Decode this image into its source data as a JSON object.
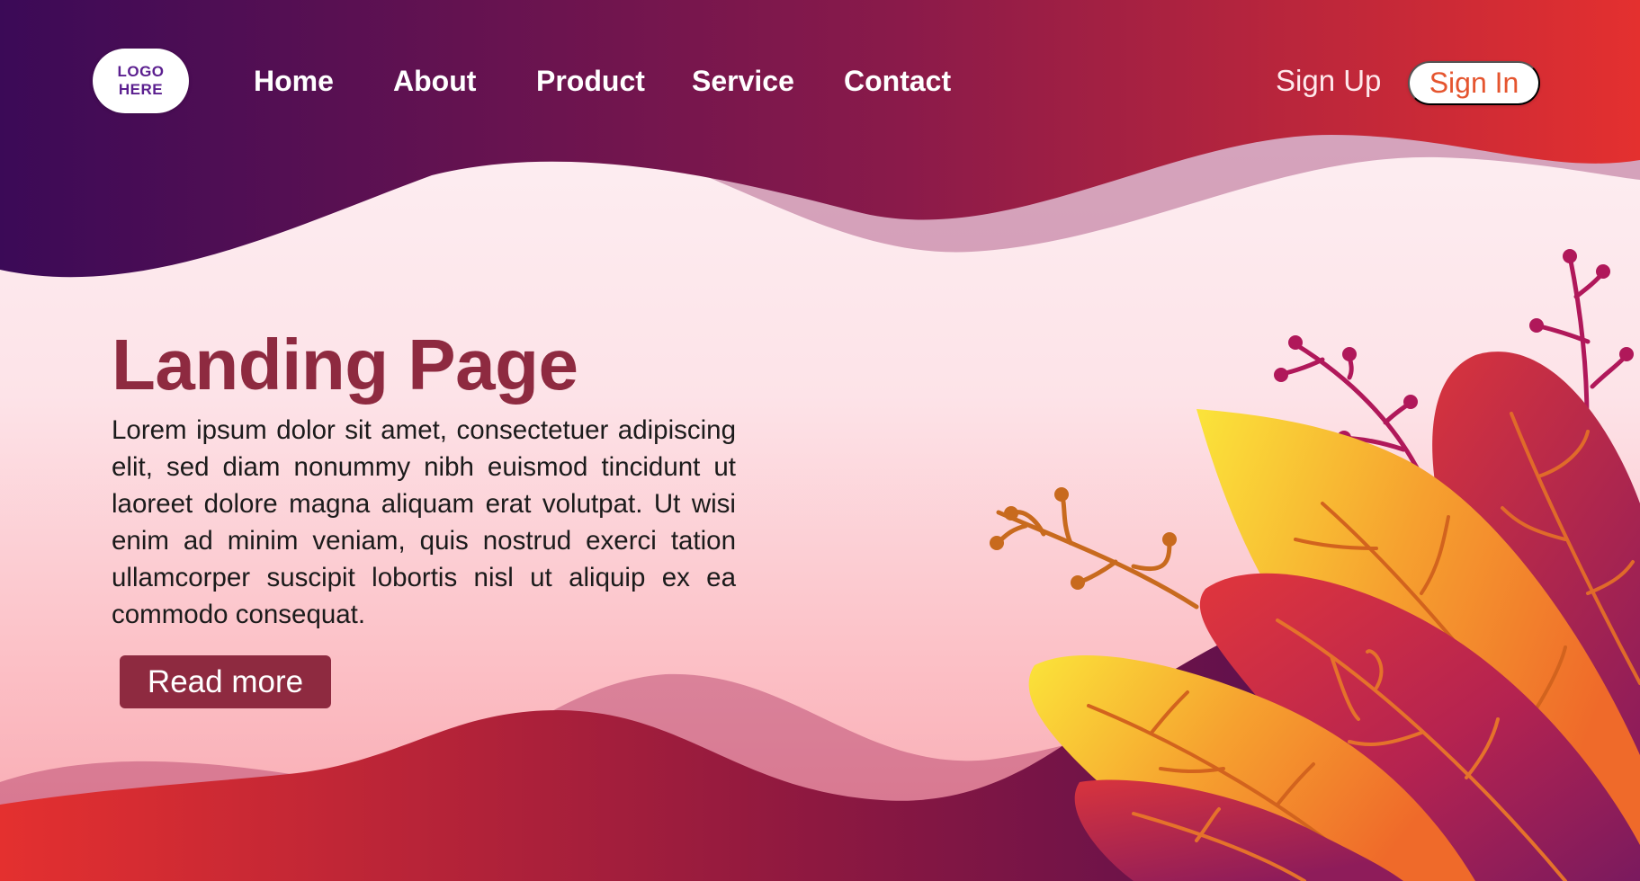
{
  "header": {
    "logo_line1": "LOGO",
    "logo_line2": "HERE",
    "nav": [
      {
        "label": "Home"
      },
      {
        "label": "About"
      },
      {
        "label": "Product"
      },
      {
        "label": "Service"
      },
      {
        "label": "Contact"
      }
    ],
    "signup_label": "Sign Up",
    "signin_label": "Sign In"
  },
  "hero": {
    "title": "Landing Page",
    "body": "Lorem ipsum dolor sit amet, consectetuer adip­iscing elit, sed diam nonummy nibh euismod tincidunt ut laoreet dolore magna aliquam erat volutpat. Ut wisi enim ad minim veniam, quis nostrud exerci tation ullamcorper suscipit lob­ortis nisl ut aliquip ex ea commodo consequat.",
    "cta_label": "Read more"
  },
  "colors": {
    "purple_dark": "#3b0a57",
    "red_bright": "#e4302f",
    "title_maroon": "#8e2a40",
    "signin_text": "#e5552f",
    "leaf_yellow": "#fbe43a",
    "leaf_orange": "#f17a2b",
    "leaf_red": "#d63a3f",
    "branch_magenta": "#b0185a"
  }
}
